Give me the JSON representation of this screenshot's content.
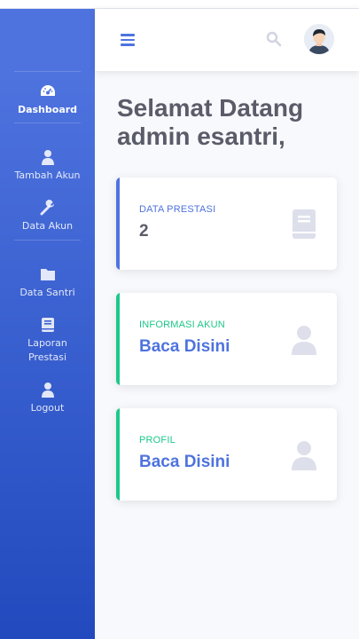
{
  "sidebar": {
    "items": [
      {
        "label": "Dashboard",
        "icon": "dashboard-icon",
        "active": true
      },
      {
        "label": "Tambah Akun",
        "icon": "user-icon"
      },
      {
        "label": "Data Akun",
        "icon": "wrench-icon"
      },
      {
        "label": "Data Santri",
        "icon": "folder-icon"
      },
      {
        "label": "Laporan Prestasi",
        "icon": "book-icon"
      },
      {
        "label": "Logout",
        "icon": "user-icon"
      }
    ]
  },
  "topbar": {
    "menu_icon": "hamburger-icon",
    "search_icon": "search-icon",
    "avatar_icon": "avatar"
  },
  "welcome": {
    "text": "Selamat Datang admin esantri,"
  },
  "cards": [
    {
      "title": "DATA PRESTASI",
      "value": "2",
      "accent": "#4e73df",
      "icon": "book-icon"
    },
    {
      "title": "INFORMASI AKUN",
      "value": "Baca Disini",
      "accent": "#1cc88a",
      "icon": "user-icon"
    },
    {
      "title": "PROFIL",
      "value": "Baca Disini",
      "accent": "#1cc88a",
      "icon": "user-icon"
    }
  ],
  "colors": {
    "primary": "#4e73df",
    "success": "#1cc88a",
    "icon_gray": "#dddfeb"
  }
}
